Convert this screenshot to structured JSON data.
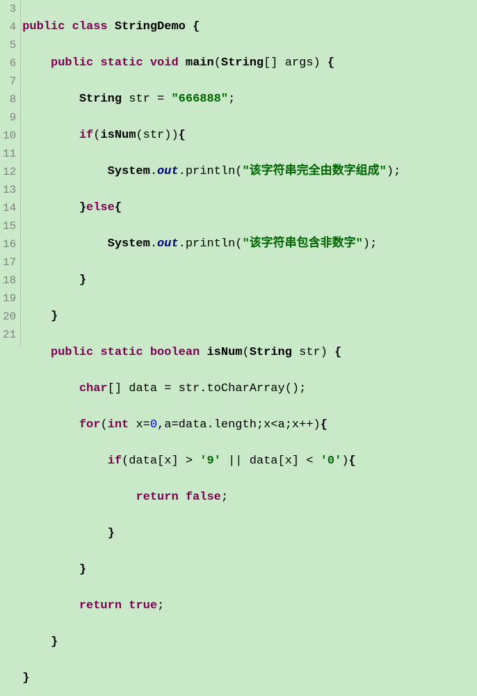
{
  "gutter": {
    "3": "3",
    "4": "4",
    "5": "5",
    "6": "6",
    "7": "7",
    "8": "8",
    "9": "9",
    "10": "10",
    "11": "11",
    "12": "12",
    "13": "13",
    "14": "14",
    "15": "15",
    "16": "16",
    "17": "17",
    "18": "18",
    "19": "19",
    "20": "20",
    "21": "21"
  },
  "kw": {
    "public": "public",
    "class": "class",
    "static": "static",
    "void": "void",
    "if": "if",
    "else": "else",
    "boolean": "boolean",
    "char": "char",
    "for": "for",
    "int": "int",
    "return": "return"
  },
  "cls": {
    "StringDemo": "StringDemo",
    "String": "String",
    "System": "System"
  },
  "mth": {
    "main": "main",
    "isNum": "isNum",
    "println": "println",
    "toCharArray": "toCharArray",
    "length": "length"
  },
  "field": {
    "out": "out"
  },
  "id": {
    "args": "args",
    "str": "str",
    "data": "data",
    "x": "x",
    "a": "a"
  },
  "str": {
    "s666888": "\"666888\"",
    "msg1": "\"该字符串完全由数字组成\"",
    "msg2": "\"该字符串包含非数字\""
  },
  "chr": {
    "nine": "'9'",
    "zero": "'0'"
  },
  "num": {
    "zero": "0"
  },
  "bool": {
    "false": "false",
    "true": "true"
  },
  "pun": {
    "lbrace": " {",
    "rbrace": "}",
    "lparen": "(",
    "rparen": ")",
    "lbrack": "[]",
    "lsqb": "[",
    "rsqb": "]",
    "semi": ";",
    "comma": ",",
    "dot": ".",
    "eq": " = ",
    "gt": " > ",
    "lt": " < ",
    "or": " || ",
    "inc": "++",
    "sp": " "
  }
}
